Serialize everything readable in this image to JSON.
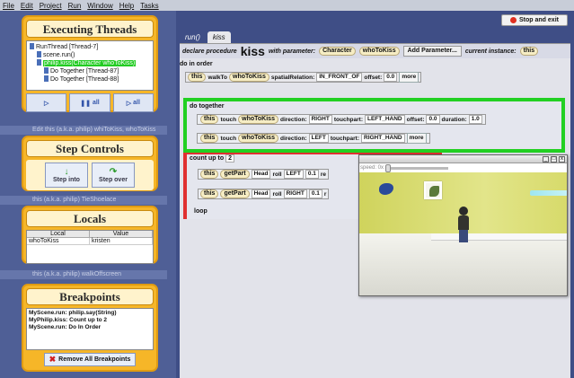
{
  "menu": [
    "File",
    "Edit",
    "Project",
    "Run",
    "Window",
    "Help",
    "Tasks"
  ],
  "background_ghosts": [
    "Edit   this (a.k.a. philip) whiToKiss, whoToKiss",
    "this (a.k.a. philip) TieShoelace",
    "this (a.k.a. philip) walkOffscreen"
  ],
  "threads": {
    "title": "Executing Threads",
    "tree": [
      "RunThread [Thread-7]",
      "scene.run()",
      "philip.kiss(Character whoToKiss)",
      "Do Together [Thread-87]",
      "Do Together [Thread-88]"
    ],
    "buttons": {
      "play": "",
      "pause_all": "all",
      "play_all": "all"
    }
  },
  "steps": {
    "title": "Step Controls",
    "step_into": "Step into",
    "step_over": "Step over"
  },
  "locals": {
    "title": "Locals",
    "headers": [
      "Local",
      "Value"
    ],
    "rows": [
      {
        "local": "whoToKiss",
        "value": "kristen"
      }
    ]
  },
  "breakpoints": {
    "title": "Breakpoints",
    "items": [
      "MyScene.run: philip.say(String)",
      "MyPhilip.kiss: Count up to 2",
      "MyScene.run: Do In Order"
    ],
    "remove_all": "Remove All Breakpoints"
  },
  "toolbar": {
    "stop_and_exit": "Stop and exit"
  },
  "tabs": [
    {
      "label": "run()"
    },
    {
      "label": "kiss"
    }
  ],
  "declaration": {
    "prefix": "declare procedure",
    "name": "kiss",
    "with_param": "with parameter:",
    "param_type": "Character",
    "param_name": "whoToKiss",
    "add_param": "Add Parameter...",
    "current_instance": "current instance:",
    "instance": "this"
  },
  "code": {
    "do_in_order": "do in order",
    "line1": {
      "subject": "this",
      "verb": "walkTo",
      "target": "whoToKiss",
      "arg1_label": "spatialRelation:",
      "arg1": "IN_FRONT_OF",
      "arg2_label": "offset:",
      "arg2": "0.0",
      "more": "more"
    },
    "do_together": "do together",
    "line2": {
      "subject": "this",
      "verb": "touch",
      "target": "whoToKiss",
      "dir_label": "direction:",
      "dir": "RIGHT",
      "tp_label": "touchpart:",
      "tp": "LEFT_HAND",
      "off_label": "offset:",
      "off": "0.0",
      "dur_label": "duration:",
      "dur": "1.0"
    },
    "line3": {
      "subject": "this",
      "verb": "touch",
      "target": "whoToKiss",
      "dir_label": "direction:",
      "dir": "LEFT",
      "tp_label": "touchpart:",
      "tp": "RIGHT_HAND",
      "more": "more"
    },
    "count_up_to": "count up to",
    "count_value": "2",
    "line4": {
      "subject": "this",
      "getpart": "getPart",
      "part": "Head",
      "roll": "roll",
      "dir": "LEFT",
      "amt": "0.1",
      "tail": "re"
    },
    "line5": {
      "subject": "this",
      "getpart": "getPart",
      "part": "Head",
      "roll": "roll",
      "dir": "RIGHT",
      "amt": "0.1",
      "tail": "r"
    },
    "loop": "loop"
  },
  "scene": {
    "speed_label": "speed: 0x",
    "speed_fraction": 0.0
  }
}
